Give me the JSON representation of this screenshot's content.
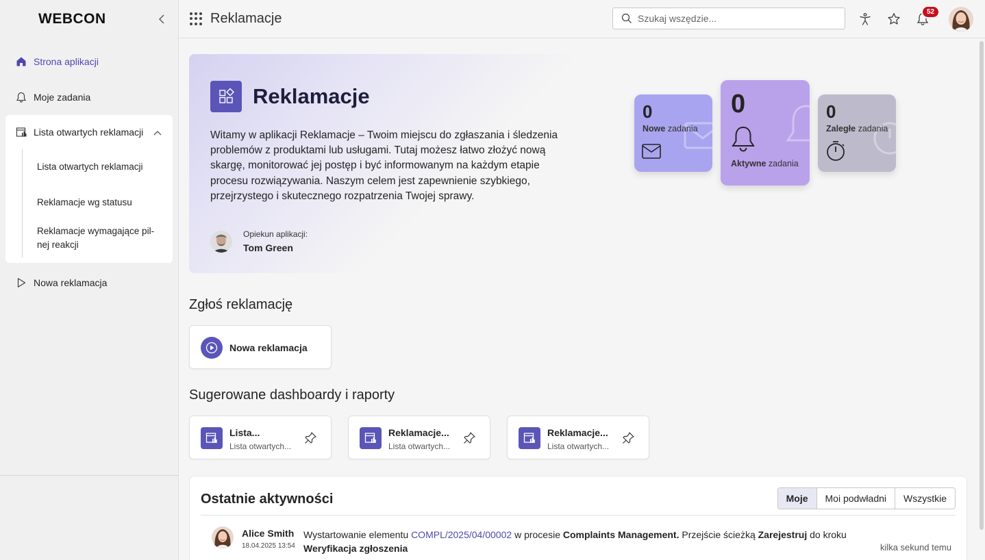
{
  "logo": "WEBCON",
  "sidebar": {
    "items": [
      {
        "label": "Strona aplikacji",
        "icon": "home-icon"
      },
      {
        "label": "Moje zadania",
        "icon": "bell-icon"
      },
      {
        "label": "Lista otwartych reklamacji",
        "icon": "report-icon"
      },
      {
        "label": "Nowa reklamacja",
        "icon": "play-icon"
      }
    ],
    "subitems": [
      {
        "label": "Lista otwartych reklamacji"
      },
      {
        "label": "Reklamacje wg statusu"
      },
      {
        "label": "Reklamacje wymagające pil-nej reakcji"
      }
    ]
  },
  "topbar": {
    "title": "Reklamacje",
    "search_placeholder": "Szukaj wszędzie...",
    "notifications_count": "52"
  },
  "hero": {
    "title": "Reklamacje",
    "description": "Witamy w aplikacji Reklamacje – Twoim miejscu do zgłaszania i śledzenia problemów z produktami lub usługami. Tutaj możesz łatwo złożyć nową skargę, monitorować jej postęp i być informowanym na każdym etapie procesu rozwiązywania. Naszym celem jest zapewnienie szybkiego, przejrzystego i skutecznego rozpatrzenia Twojej sprawy.",
    "owner_label": "Opiekun aplikacji:",
    "owner_name": "Tom Green"
  },
  "tiles": {
    "new": {
      "count": "0",
      "bold": "Nowe",
      "text": "zadania",
      "color": "#a9a4ef"
    },
    "active": {
      "count": "0",
      "bold": "Aktywne",
      "text": "zadania",
      "color": "#b9a2ea"
    },
    "overdue": {
      "count": "0",
      "bold": "Zaległe",
      "text": "zadania",
      "color": "#bdbbcb"
    }
  },
  "report_section": {
    "title": "Zgłoś reklamację",
    "start_label": "Nowa reklamacja"
  },
  "dashboards": {
    "title": "Sugerowane dashboardy i raporty",
    "items": [
      {
        "title": "Lista...",
        "subtitle": "Lista otwartych..."
      },
      {
        "title": "Reklamacje...",
        "subtitle": "Lista otwartych..."
      },
      {
        "title": "Reklamacje...",
        "subtitle": "Lista otwartych..."
      }
    ]
  },
  "activity": {
    "title": "Ostatnie aktywności",
    "filters": [
      "Moje",
      "Moi podwładni",
      "Wszystkie"
    ],
    "entries": [
      {
        "user": "Alice Smith",
        "timestamp": "18.04.2025 13:54",
        "text_start": "Wystartowanie elementu",
        "link": "COMPL/2025/04/00002",
        "text_mid": "w procesie",
        "process": "Complaints Management.",
        "text_path": "Przejście ścieżką",
        "path": "Zarejestruj",
        "text_step": "do kroku",
        "step": "Weryfikacja zgłoszenia",
        "relative_time": "kilka sekund temu"
      }
    ]
  }
}
